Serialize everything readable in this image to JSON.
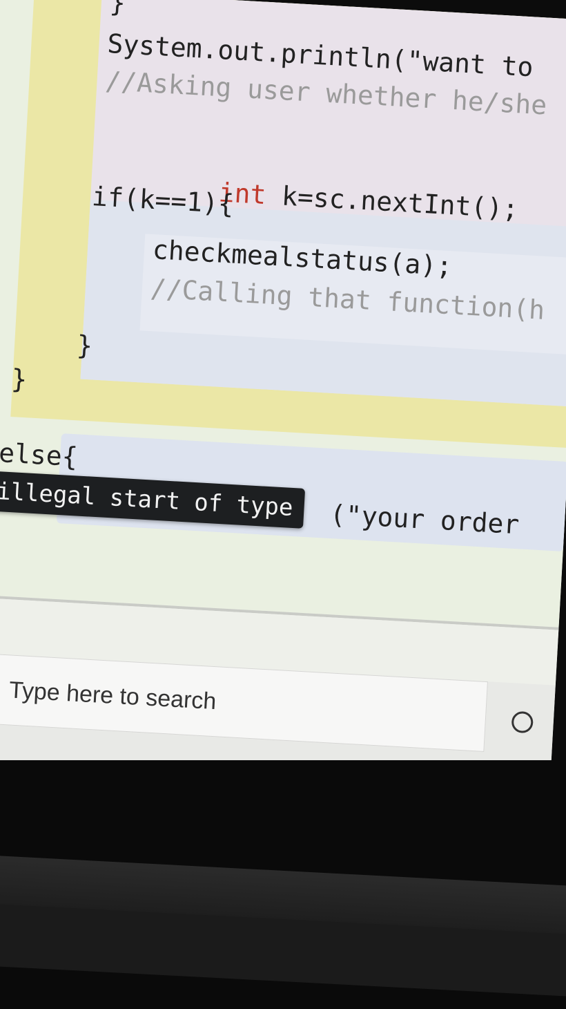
{
  "editor": {
    "lines": {
      "brace_top": "}",
      "println_want": "System.out.println(\"want to",
      "comment_asking": "//Asking user whether he/she",
      "int_keyword": "int",
      "int_rest": " k=sc.nextInt();",
      "if_line": "if(k==1){",
      "call_check": "checkmealstatus(a);",
      "comment_calling": "//Calling that function(h",
      "if_close": "}",
      "method_close": "}",
      "else_line": "else{",
      "else_println": "(\"your order"
    },
    "error_tooltip": "illegal start of type",
    "colors": {
      "keyword": "#c0392b",
      "comment": "#9a9a9a",
      "tooltip_bg": "#1d1f21"
    }
  },
  "taskbar": {
    "search_placeholder": "Type here to search",
    "search_icon": "search-icon",
    "cortana_icon": "cortana-icon"
  }
}
